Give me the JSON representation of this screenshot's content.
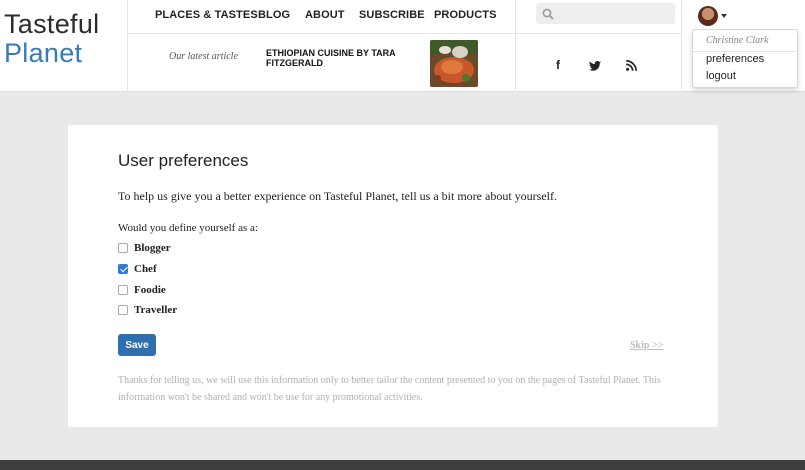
{
  "brand": {
    "line1": "Tasteful",
    "line2": "Planet"
  },
  "nav": {
    "items": [
      {
        "label": "PLACES & TASTES"
      },
      {
        "label": "BLOG"
      },
      {
        "label": "ABOUT"
      },
      {
        "label": "SUBSCRIBE"
      },
      {
        "label": "PRODUCTS"
      }
    ]
  },
  "latest": {
    "label": "Our latest article",
    "title": "ETHIOPIAN CUISINE by TARA FITZGERALD"
  },
  "search": {
    "placeholder": ""
  },
  "social": {
    "facebook": "f",
    "twitter": "twitter-icon",
    "rss": "rss-icon"
  },
  "user": {
    "name": "Christine Clark",
    "menu": [
      {
        "label": "preferences"
      },
      {
        "label": "logout"
      }
    ]
  },
  "page": {
    "title": "User preferences",
    "intro": "To help us give you a better experience on Tasteful Planet, tell us a bit more about yourself.",
    "question": "Would you define yourself as a:",
    "options": [
      {
        "label": "Blogger",
        "checked": false
      },
      {
        "label": "Chef",
        "checked": true
      },
      {
        "label": "Foodie",
        "checked": false
      },
      {
        "label": "Traveller",
        "checked": false
      }
    ],
    "save_label": "Save",
    "skip_label": "Skip >>",
    "note": "Thanks for telling us, we will use this information only to better tailor the content presented to you on the pages of Tasteful Planet. This information won't be shared and won't be use for any promotional activities."
  },
  "colors": {
    "brand_blue": "#3a78b6",
    "button": "#2f6fad",
    "checkbox": "#2f7dd1",
    "footer": "#3e3e3e"
  }
}
